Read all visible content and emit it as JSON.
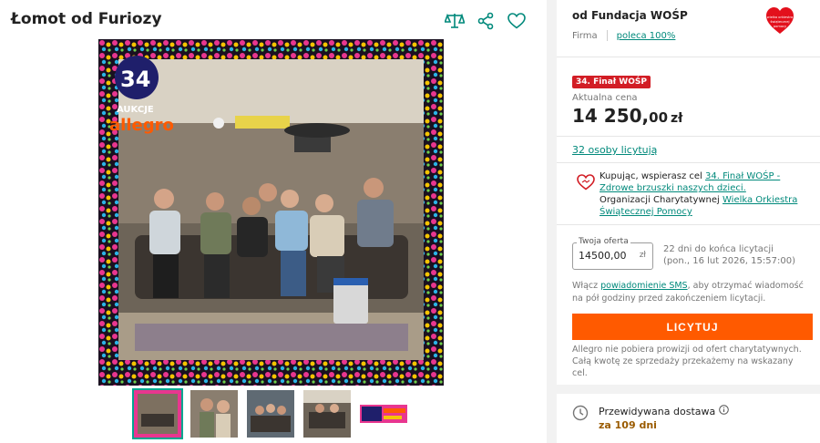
{
  "listing": {
    "title": "Łomot od Furiozy"
  },
  "icons": {
    "compare": "compare-icon",
    "share": "share-icon",
    "favorite": "heart-icon"
  },
  "seller": {
    "name": "od Fundacja WOŚP",
    "type": "Firma",
    "recommend": "poleca 100%",
    "logo_text": "wielka orkiestra świątecznej pomocy"
  },
  "offer": {
    "badge": "34. Finał WOŚP",
    "price_label": "Aktualna cena",
    "price_int": "14 250,",
    "price_dec": "00",
    "currency": "zł",
    "bidders": "32 osoby licytują"
  },
  "charity": {
    "text1": "Kupując, wspierasz cel ",
    "goal_link": "34. Finał WOŚP - Zdrowe brzuszki naszych dzieci.",
    "text2": "Organizacji Charytatywnej ",
    "org_link": "Wielka Orkiestra Świątecznej Pomocy"
  },
  "bid": {
    "legend": "Twoja oferta",
    "value": "14500,00",
    "currency": "zł",
    "time_left": "22 dni do końca licytacji",
    "end_date": "(pon., 16 lut 2026, 15:57:00)"
  },
  "sms": {
    "prefix": "Włącz ",
    "link": "powiadomienie SMS",
    "suffix": ", aby otrzymać wiadomość na pół godziny przed zakończeniem licytacji."
  },
  "button": {
    "bid_label": "LICYTUJ"
  },
  "note": "Allegro nie pobiera prowizji od ofert charytatywnych. Całą kwotę ze sprzedaży przekażemy na wskazany cel.",
  "delivery": {
    "label": "Przewidywana dostawa",
    "value": "za 109 dni"
  },
  "image": {
    "overlay_number": "34",
    "overlay_word": "AUKCJE",
    "overlay_brand": "allegro"
  },
  "colors": {
    "accent": "#00897b",
    "buy_button": "#ff5a00",
    "badge": "#d21d25"
  }
}
